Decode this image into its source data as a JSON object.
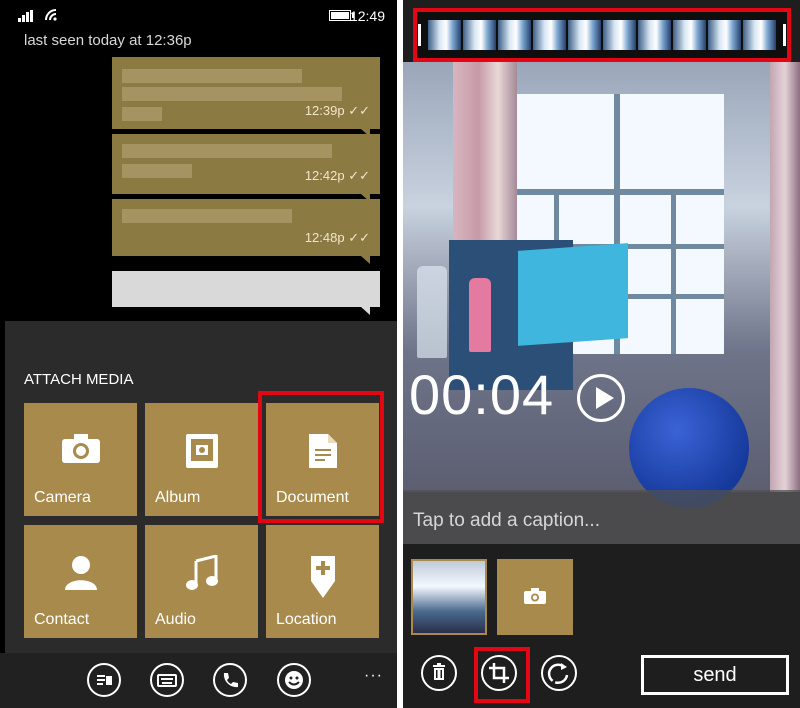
{
  "status_bar": {
    "time": "12:49"
  },
  "chat": {
    "last_seen": "last seen today at 12:36p",
    "messages": [
      {
        "time": "12:39p",
        "ticks": "✓✓"
      },
      {
        "time": "12:42p",
        "ticks": "✓✓"
      },
      {
        "time": "12:48p",
        "ticks": "✓✓"
      }
    ]
  },
  "attach_media": {
    "title": "ATTACH MEDIA",
    "tiles": [
      {
        "label": "Camera",
        "icon": "camera-icon"
      },
      {
        "label": "Album",
        "icon": "album-icon"
      },
      {
        "label": "Document",
        "icon": "document-icon"
      },
      {
        "label": "Contact",
        "icon": "contact-icon"
      },
      {
        "label": "Audio",
        "icon": "audio-icon"
      },
      {
        "label": "Location",
        "icon": "location-add-icon"
      }
    ]
  },
  "left_appbar": {
    "buttons": [
      "emoji-sticker-icon",
      "keyboard-icon",
      "phone-icon",
      "smiley-icon"
    ],
    "more": "···"
  },
  "video_editor": {
    "duration": "00:04",
    "caption_placeholder": "Tap to add a caption...",
    "send_label": "send",
    "buttons": [
      "delete-icon",
      "crop-icon",
      "rotate-icon"
    ]
  },
  "colors": {
    "accent_gold": "#a88a4c",
    "bubble_gold": "#8c7a43",
    "highlight_red": "#e30613",
    "panel_dark": "#2b2b2b"
  }
}
